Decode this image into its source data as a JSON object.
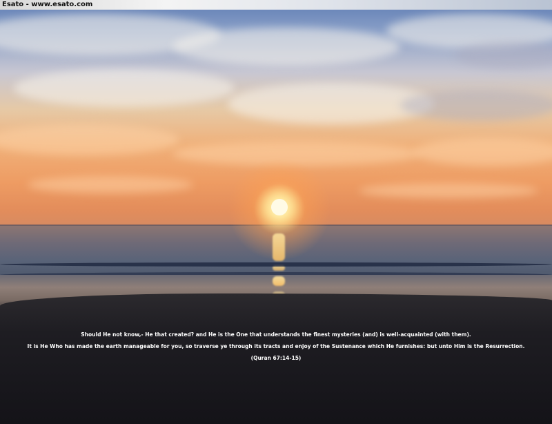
{
  "window": {
    "title": "Esato - www.esato.com"
  },
  "caption": {
    "line1": "Should He not know,- He that created? and He is the One that understands the finest mysteries (and) is well-acquainted (with them).",
    "line2": "It is He Who has made the earth manageable for you, so traverse ye through its tracts and enjoy of the Sustenance which He furnishes: but unto Him is the Resurrection.",
    "reference": "(Quran 67:14-15)"
  },
  "colors": {
    "caption_text": "#ffffff",
    "sun": "#fffbe6",
    "sky_top": "#5f7db4",
    "sky_horizon": "#e38d5b",
    "sand": "#1e1d22"
  }
}
